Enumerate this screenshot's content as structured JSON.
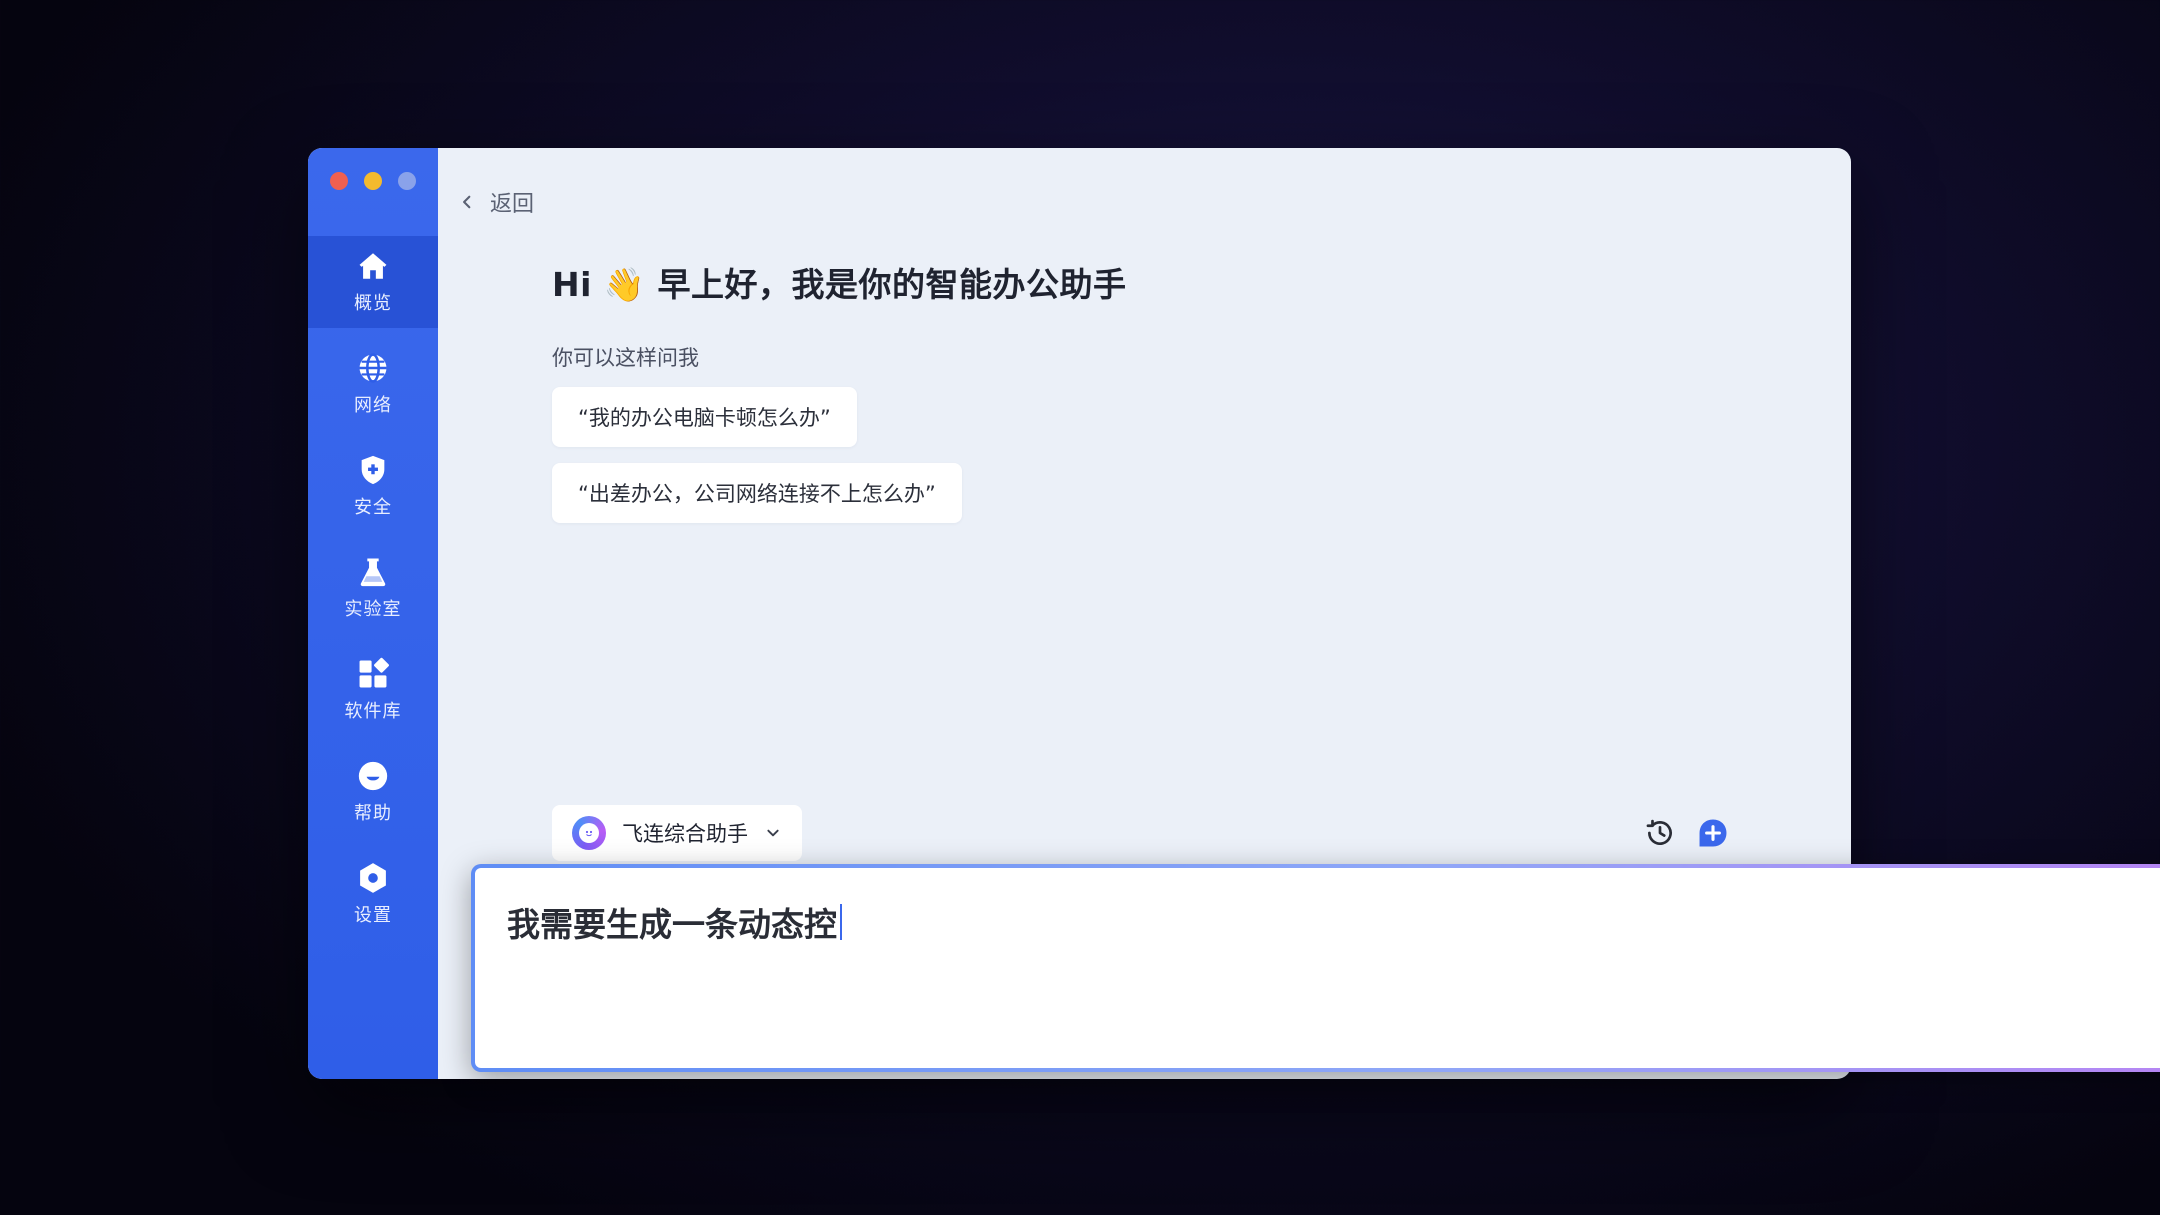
{
  "window": {
    "controls": [
      "close",
      "minimize",
      "maximize"
    ]
  },
  "sidebar": {
    "items": [
      {
        "label": "概览",
        "icon": "home-icon",
        "active": true
      },
      {
        "label": "网络",
        "icon": "globe-icon",
        "active": false
      },
      {
        "label": "安全",
        "icon": "shield-icon",
        "active": false
      },
      {
        "label": "实验室",
        "icon": "flask-icon",
        "active": false
      },
      {
        "label": "软件库",
        "icon": "apps-grid-icon",
        "active": false
      },
      {
        "label": "帮助",
        "icon": "help-chat-icon",
        "active": false
      },
      {
        "label": "设置",
        "icon": "gear-icon",
        "active": false
      }
    ]
  },
  "header": {
    "back_label": "返回"
  },
  "main": {
    "greeting": "Hi 👋 早上好，我是你的智能办公助手",
    "subheading": "你可以这样问我",
    "suggestions": [
      "“我的办公电脑卡顿怎么办”",
      "“出差办公，公司网络连接不上怎么办”"
    ]
  },
  "composer": {
    "assistant_name": "飞连综合助手",
    "input_value": "我需要生成一条动态控",
    "history_icon": "history-icon",
    "new_chat_icon": "new-chat-icon"
  },
  "colors": {
    "sidebar": "#2f5ee8",
    "sidebar_active": "#2852d6",
    "main_bg": "#ebf0f8",
    "accent": "#3b68ec"
  }
}
